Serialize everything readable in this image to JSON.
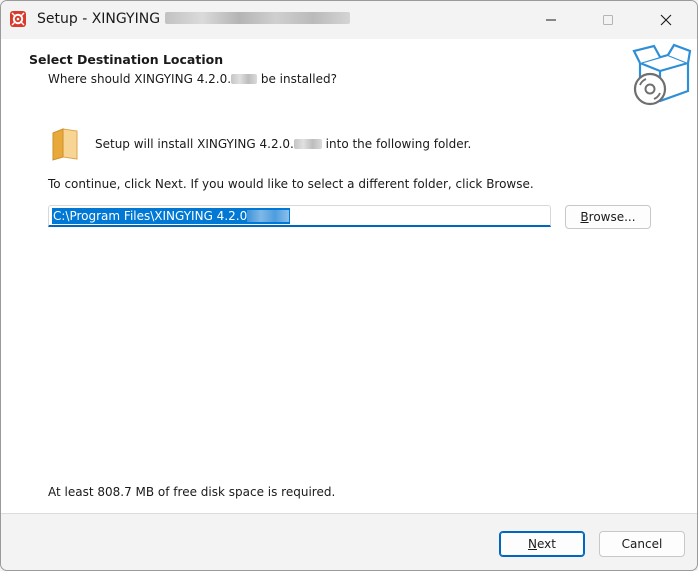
{
  "window": {
    "title": "Setup - XINGYING",
    "controls": {
      "minimize_icon": "minimize-icon",
      "maximize_icon": "maximize-icon",
      "close_icon": "close-icon"
    }
  },
  "header": {
    "title": "Select Destination Location",
    "subtitle_prefix": "Where should XINGYING 4.2.0.",
    "subtitle_suffix": " be installed?",
    "icon": "install-box-icon"
  },
  "content": {
    "install_text_prefix": "Setup will install XINGYING 4.2.0.",
    "install_text_suffix": " into the following folder.",
    "continue_text": "To continue, click Next. If you would like to select a different folder, click Browse.",
    "path_value": "C:\\Program Files\\XINGYING 4.2.0",
    "browse_label_accel": "B",
    "browse_label_rest": "rowse...",
    "disk_space_text": "At least 808.7 MB of free disk space is required.",
    "folder_icon": "folder-icon"
  },
  "footer": {
    "next_label_accel": "N",
    "next_label_rest": "ext",
    "cancel_label": "Cancel"
  },
  "colors": {
    "accent": "#0067c0",
    "selection": "#0078d4",
    "app_icon": "#d93a2a",
    "box_icon": "#2f8fd6"
  }
}
